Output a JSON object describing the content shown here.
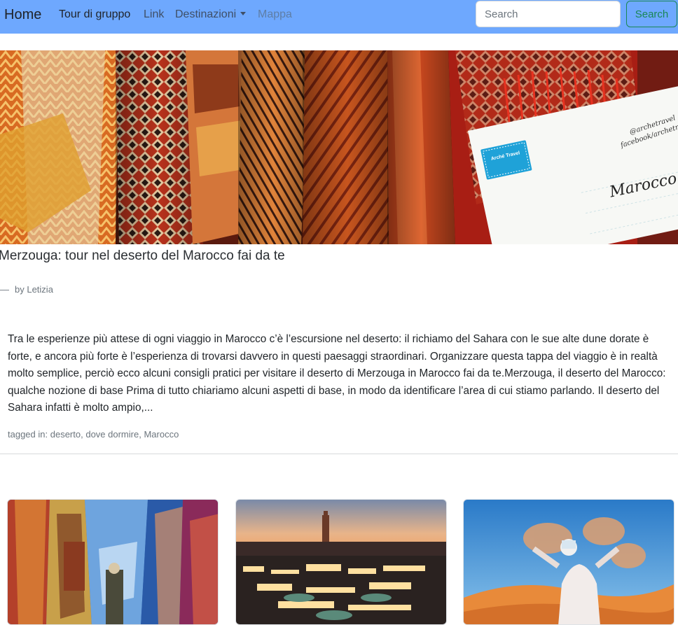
{
  "navbar": {
    "brand": "Home",
    "links": [
      {
        "label": "Tour di gruppo"
      },
      {
        "label": "Link"
      },
      {
        "label": "Destinazioni"
      },
      {
        "label": "Mappa"
      }
    ],
    "search_placeholder": "Search",
    "search_button": "Search",
    "background_color": "#6ea8fe",
    "button_color": "#198754"
  },
  "hero": {
    "image_alt": "Moroccan carpets with Arché Travel postcard",
    "postcard_text": "Marocco",
    "stamp_text": "Arché Travel",
    "postcard_handle_1": "@archetravel",
    "postcard_handle_2": "facebook/archetravel"
  },
  "post": {
    "title": "Merzouga: tour nel deserto del Marocco fai da te",
    "dash": "—",
    "byline": "by Letizia",
    "excerpt": "Tra le esperienze più attese di ogni viaggio in Marocco c’è l’escursione nel deserto: il richiamo del Sahara con le sue alte dune dorate è forte, e ancora più forte è l’esperienza di trovarsi davvero in questi paesaggi straordinari. Organizzare questa tappa del viaggio è in realtà molto semplice, perciò ecco alcuni consigli pratici per visitare il deserto di Merzouga in Marocco fai da te.Merzouga, il deserto del Marocco: qualche nozione di base Prima di tutto chiariamo alcuni aspetti di base, in modo da identificare l’area di cui stiamo parlando. Il deserto del Sahara infatti è molto ampio,...",
    "tags_prefix": "tagged in:",
    "tags": [
      "deserto",
      "dove dormire",
      "Marocco"
    ]
  },
  "cards": [
    {
      "image_alt": "Blue streets of Chefchaouen with carpets"
    },
    {
      "image_alt": "Jemaa el-Fnaa square in Marrakech at dusk"
    },
    {
      "image_alt": "Person throwing sand in the Sahara desert"
    }
  ]
}
